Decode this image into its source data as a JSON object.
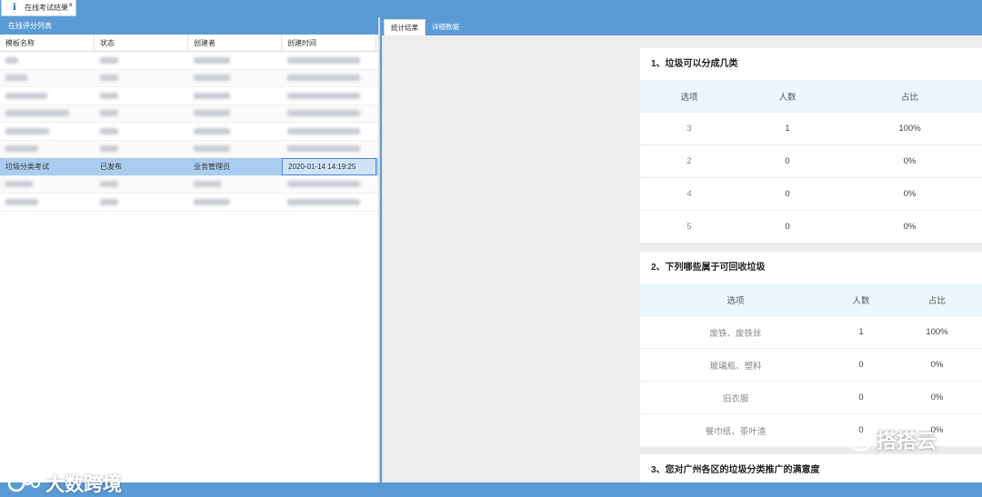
{
  "window": {
    "tab_label": "在线考试结果",
    "close_glyph": "×",
    "info_glyph": "i"
  },
  "left_panel": {
    "title": "在线评分列表",
    "columns": [
      "模板名称",
      "状态",
      "创建者",
      "创建时间"
    ],
    "selected_row": {
      "name": "垃圾分类考试",
      "status": "已发布",
      "creator": "业务管理员",
      "created": "2020-01-14 14:19:25"
    }
  },
  "right_panel": {
    "tabs": [
      "统计结果",
      "详细数据"
    ],
    "questions": [
      {
        "title": "1、垃圾可以分成几类",
        "headers": [
          "选项",
          "人数",
          "占比"
        ],
        "rows": [
          {
            "option": "3",
            "count": "1",
            "ratio": "100%"
          },
          {
            "option": "2",
            "count": "0",
            "ratio": "0%"
          },
          {
            "option": "4",
            "count": "0",
            "ratio": "0%"
          },
          {
            "option": "5",
            "count": "0",
            "ratio": "0%"
          }
        ]
      },
      {
        "title": "2、下列哪些属于可回收垃圾",
        "headers": [
          "选项",
          "人数",
          "占比"
        ],
        "rows": [
          {
            "option": "废铁、废铁丝",
            "count": "1",
            "ratio": "100%"
          },
          {
            "option": "玻璃瓶、塑料",
            "count": "0",
            "ratio": "0%"
          },
          {
            "option": "旧衣服",
            "count": "0",
            "ratio": "0%"
          },
          {
            "option": "餐巾纸、茶叶渣",
            "count": "0",
            "ratio": "0%"
          }
        ]
      },
      {
        "title": "3、您对广州各区的垃圾分类推广的满意度"
      }
    ]
  },
  "watermarks": {
    "left": "大数跨境",
    "right": "搭搭云"
  }
}
